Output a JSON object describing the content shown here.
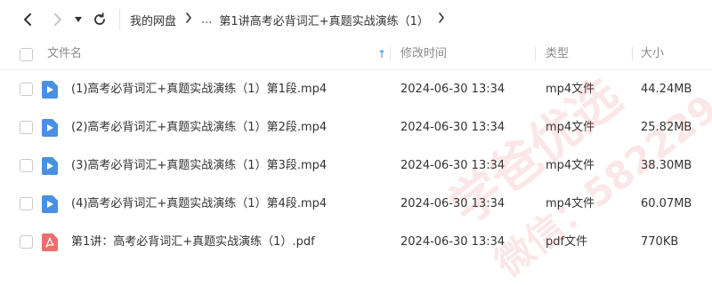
{
  "nav": {
    "breadcrumb_root": "我的网盘",
    "breadcrumb_ellipsis": "...",
    "breadcrumb_current": "第1讲高考必背词汇+真题实战演练（1）"
  },
  "header": {
    "name": "文件名",
    "sort_arrow": "↑",
    "modified": "修改时间",
    "type": "类型",
    "size": "大小"
  },
  "files": [
    {
      "name": "(1)高考必背词汇+真题实战演练（1）第1段.mp4",
      "time": "2024-06-30 13:34",
      "type": "mp4文件",
      "size": "44.24MB",
      "icon": "video-file-icon"
    },
    {
      "name": "(2)高考必背词汇+真题实战演练（1）第2段.mp4",
      "time": "2024-06-30 13:34",
      "type": "mp4文件",
      "size": "25.82MB",
      "icon": "video-file-icon"
    },
    {
      "name": "(3)高考必背词汇+真题实战演练（1）第3段.mp4",
      "time": "2024-06-30 13:34",
      "type": "mp4文件",
      "size": "38.30MB",
      "icon": "video-file-icon"
    },
    {
      "name": "(4)高考必背词汇+真题实战演练（1）第4段.mp4",
      "time": "2024-06-30 13:34",
      "type": "mp4文件",
      "size": "60.07MB",
      "icon": "video-file-icon"
    },
    {
      "name": "第1讲：高考必背词汇+真题实战演练（1）.pdf",
      "time": "2024-06-30 13:34",
      "type": "pdf文件",
      "size": "770KB",
      "icon": "pdf-file-icon"
    }
  ],
  "watermark": {
    "line1": "学爸优选",
    "line2": "微信：582229"
  },
  "colors": {
    "video_icon": "#4a90e2",
    "pdf_icon": "#f06b6b",
    "sort_arrow": "#3a86e8",
    "watermark": "#e04040"
  }
}
